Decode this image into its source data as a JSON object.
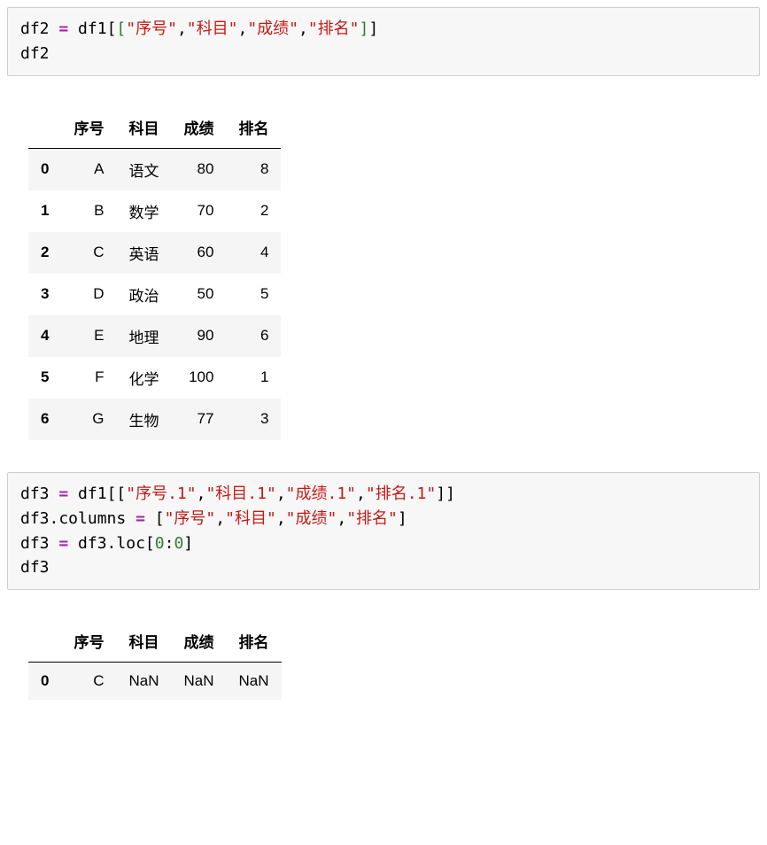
{
  "code1": {
    "var_df2": "df2",
    "assign": "=",
    "var_df1": "df1",
    "lbrack": "[",
    "rbrack": "]",
    "glb": "[",
    "grb": "]",
    "s1": "\"序号\"",
    "s2": "\"科目\"",
    "s3": "\"成绩\"",
    "s4": "\"排名\"",
    "comma": ",",
    "line2": "df2"
  },
  "table1": {
    "columns": {
      "index": "",
      "c1": "序号",
      "c2": "科目",
      "c3": "成绩",
      "c4": "排名"
    },
    "rows": [
      {
        "i": "0",
        "c1": "A",
        "c2": "语文",
        "c3": "80",
        "c4": "8"
      },
      {
        "i": "1",
        "c1": "B",
        "c2": "数学",
        "c3": "70",
        "c4": "2"
      },
      {
        "i": "2",
        "c1": "C",
        "c2": "英语",
        "c3": "60",
        "c4": "4"
      },
      {
        "i": "3",
        "c1": "D",
        "c2": "政治",
        "c3": "50",
        "c4": "5"
      },
      {
        "i": "4",
        "c1": "E",
        "c2": "地理",
        "c3": "90",
        "c4": "6"
      },
      {
        "i": "5",
        "c1": "F",
        "c2": "化学",
        "c3": "100",
        "c4": "1"
      },
      {
        "i": "6",
        "c1": "G",
        "c2": "生物",
        "c3": "77",
        "c4": "3"
      }
    ]
  },
  "code2": {
    "l1": {
      "var_df3": "df3",
      "assign": "=",
      "var_df1": "df1",
      "lbrack": "[",
      "rbrack": "]",
      "glb": "[",
      "grb": "]",
      "s1": "\"序号.1\"",
      "s2": "\"科目.1\"",
      "s3": "\"成绩.1\"",
      "s4": "\"排名.1\"",
      "comma": ","
    },
    "l2": {
      "lhs": "df3.columns",
      "assign": "=",
      "glb": "[",
      "grb": "]",
      "s1": "\"序号\"",
      "s2": "\"科目\"",
      "s3": "\"成绩\"",
      "s4": "\"排名\"",
      "comma": ","
    },
    "l3": {
      "var_df3": "df3",
      "assign": "=",
      "rhs_pre": "df3.loc",
      "lbrack": "[",
      "rbrack": "]",
      "n1": "0",
      "colon": ":",
      "n2": "0"
    },
    "l4": "df3"
  },
  "table2": {
    "columns": {
      "index": "",
      "c1": "序号",
      "c2": "科目",
      "c3": "成绩",
      "c4": "排名"
    },
    "rows": [
      {
        "i": "0",
        "c1": "C",
        "c2": "NaN",
        "c3": "NaN",
        "c4": "NaN"
      }
    ]
  }
}
